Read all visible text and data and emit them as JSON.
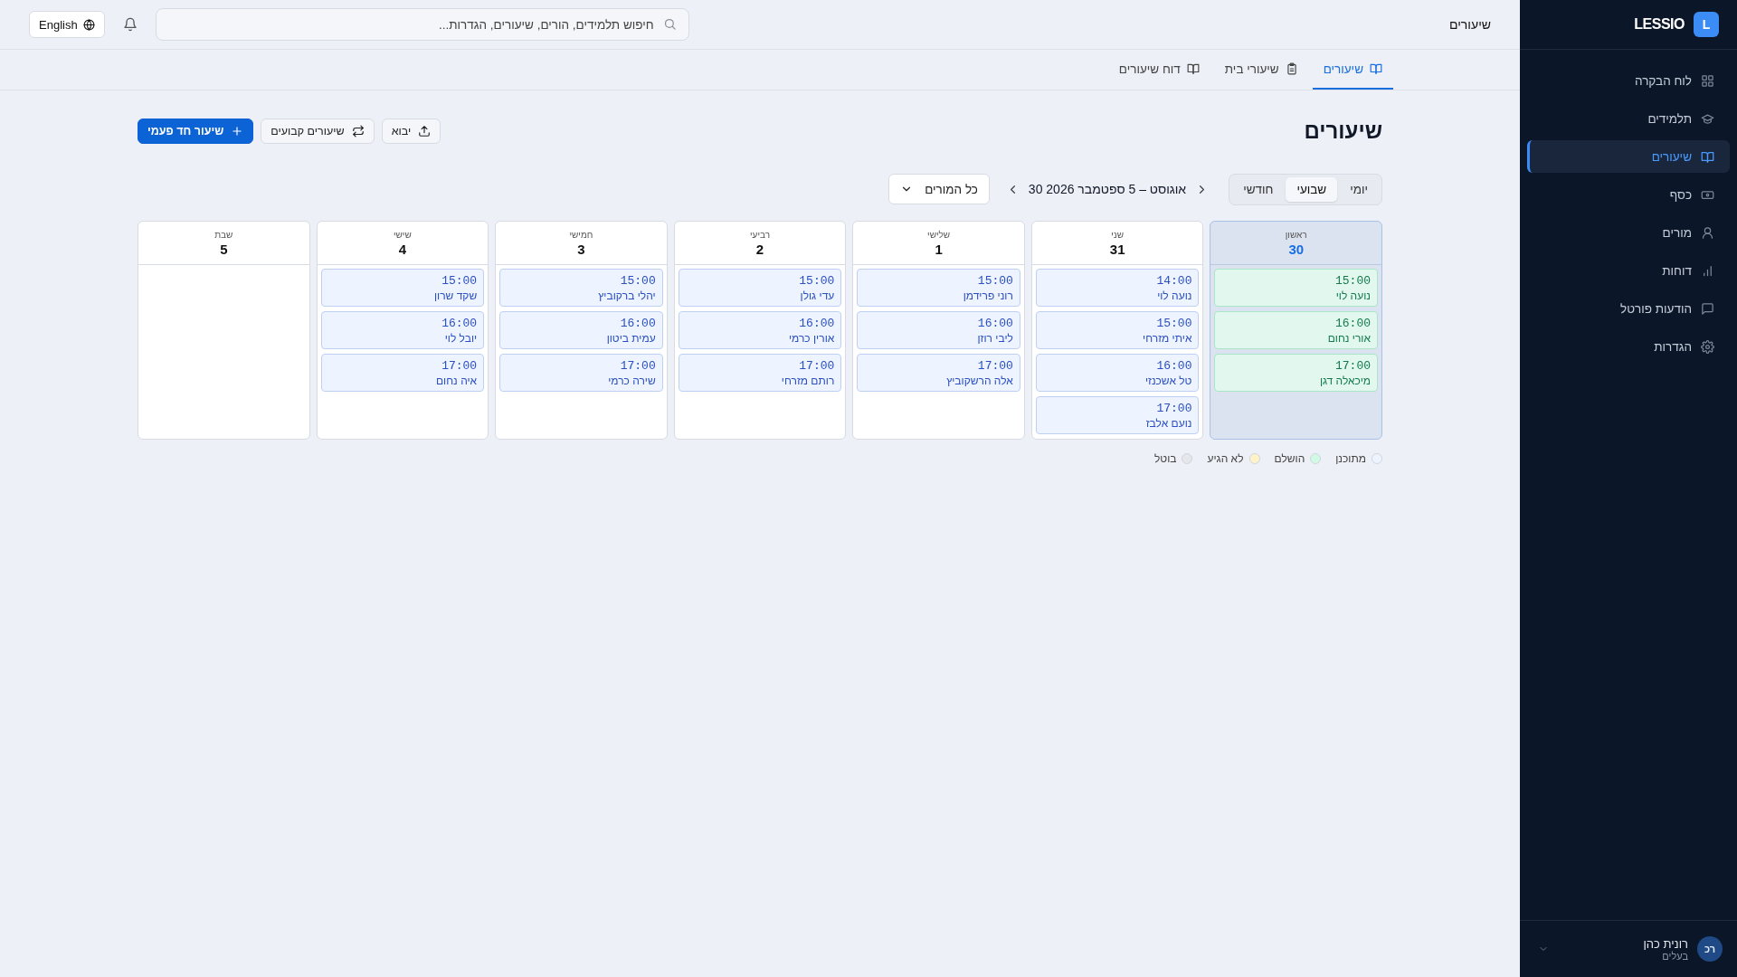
{
  "sidebar": {
    "logo_letter": "L",
    "brand": "LESSIO",
    "items": [
      {
        "label": "לוח הבקרה",
        "selected": false
      },
      {
        "label": "תלמידים",
        "selected": false
      },
      {
        "label": "שיעורים",
        "selected": true
      },
      {
        "label": "כסף",
        "selected": false
      },
      {
        "label": "מורים",
        "selected": false
      },
      {
        "label": "דוחות",
        "selected": false
      },
      {
        "label": "הודעות פורטל",
        "selected": false
      },
      {
        "label": "הגדרות",
        "selected": false
      }
    ],
    "user": {
      "initials": "רכ",
      "name": "רונית כהן",
      "role": "בעלים"
    }
  },
  "topbar": {
    "title": "שיעורים",
    "search": {
      "placeholder": "חיפוש תלמידים, הורים, שיעורים, הגדרות..."
    },
    "language": "English"
  },
  "tabs": [
    {
      "label": "שיעורים",
      "selected": true
    },
    {
      "label": "שיעורי בית",
      "selected": false
    },
    {
      "label": "דוח שיעורים",
      "selected": false
    }
  ],
  "page": {
    "title": "שיעורים",
    "buttons": [
      {
        "label": "יבוא",
        "kind": "import"
      },
      {
        "label": "שיעורים קבועים",
        "kind": "recurring"
      },
      {
        "label": "שיעור חד פעמי",
        "kind": "add"
      }
    ]
  },
  "views": [
    {
      "label": "יומי",
      "selected": false
    },
    {
      "label": "שבועי",
      "selected": true
    },
    {
      "label": "חודשי",
      "selected": false
    }
  ],
  "date_range": "30 אוגוסט – 5 ספטמבר 2026",
  "teacher_filter": "כל המורים",
  "days": [
    {
      "name": "ראשון",
      "date": "30",
      "today": true,
      "lessons": [
        {
          "time": "15:00",
          "student": "נועה לוי",
          "completed": true
        },
        {
          "time": "16:00",
          "student": "אורי נחום",
          "completed": true
        },
        {
          "time": "17:00",
          "student": "מיכאלה דגן",
          "completed": true
        }
      ]
    },
    {
      "name": "שני",
      "date": "31",
      "today": false,
      "lessons": [
        {
          "time": "14:00",
          "student": "נועה לוי",
          "completed": false
        },
        {
          "time": "15:00",
          "student": "איתי מזרחי",
          "completed": false
        },
        {
          "time": "16:00",
          "student": "טל אשכנזי",
          "completed": false
        },
        {
          "time": "17:00",
          "student": "נועם אלבז",
          "completed": false
        }
      ]
    },
    {
      "name": "שלישי",
      "date": "1",
      "today": false,
      "lessons": [
        {
          "time": "15:00",
          "student": "רוני פרידמן",
          "completed": false
        },
        {
          "time": "16:00",
          "student": "ליבי רוזן",
          "completed": false
        },
        {
          "time": "17:00",
          "student": "אלה הרשקוביץ",
          "completed": false
        }
      ]
    },
    {
      "name": "רביעי",
      "date": "2",
      "today": false,
      "lessons": [
        {
          "time": "15:00",
          "student": "עדי גולן",
          "completed": false
        },
        {
          "time": "16:00",
          "student": "אורין כרמי",
          "completed": false
        },
        {
          "time": "17:00",
          "student": "רותם מזרחי",
          "completed": false
        }
      ]
    },
    {
      "name": "חמישי",
      "date": "3",
      "today": false,
      "lessons": [
        {
          "time": "15:00",
          "student": "יהלי ברקוביץ",
          "completed": false
        },
        {
          "time": "16:00",
          "student": "עמית ביטון",
          "completed": false
        },
        {
          "time": "17:00",
          "student": "שירה כרמי",
          "completed": false
        }
      ]
    },
    {
      "name": "שישי",
      "date": "4",
      "today": false,
      "lessons": [
        {
          "time": "15:00",
          "student": "שקד שרון",
          "completed": false
        },
        {
          "time": "16:00",
          "student": "יובל לוי",
          "completed": false
        },
        {
          "time": "17:00",
          "student": "איה נחום",
          "completed": false
        }
      ]
    },
    {
      "name": "שבת",
      "date": "5",
      "today": false
    }
  ],
  "legend": [
    {
      "label": "מתוכנן",
      "color": "#eef4ff"
    },
    {
      "label": "הושלם",
      "color": "#d1fae5"
    },
    {
      "label": "לא הגיע",
      "color": "#fef3c7"
    },
    {
      "label": "בוטל",
      "color": "#e5e7eb"
    }
  ]
}
